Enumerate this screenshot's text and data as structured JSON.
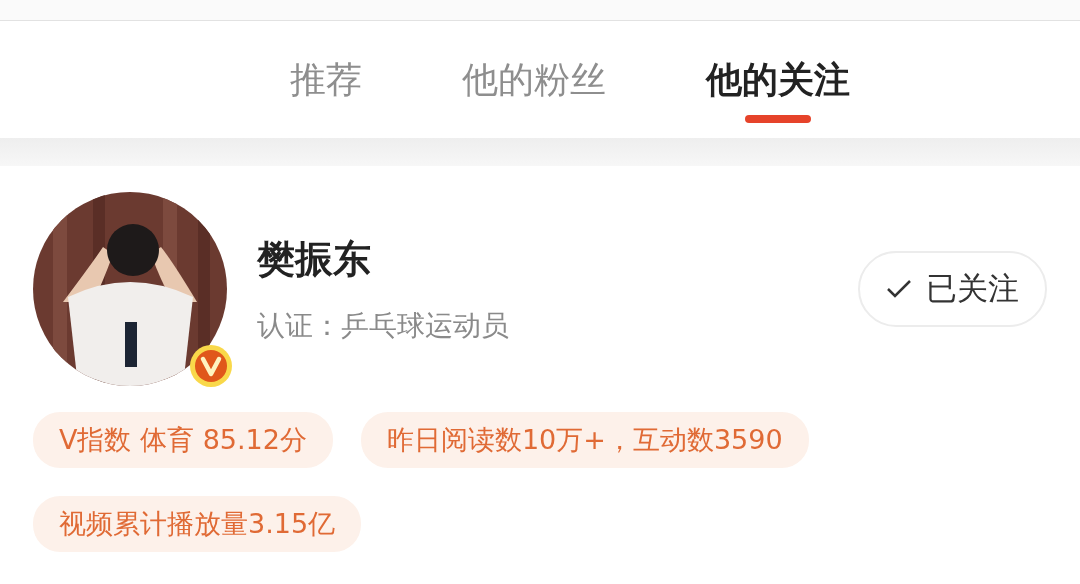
{
  "tabs": [
    {
      "label": "推荐",
      "selected": false
    },
    {
      "label": "他的粉丝",
      "selected": false
    },
    {
      "label": "他的关注",
      "selected": true
    }
  ],
  "user": {
    "verified": true,
    "name": "樊振东",
    "certification": "认证：乒乓球运动员",
    "follow_button": {
      "label": "已关注",
      "following": true
    }
  },
  "tags": [
    "V指数 体育 85.12分",
    "昨日阅读数10万+，互动数3590",
    "视频累计播放量3.15亿"
  ]
}
